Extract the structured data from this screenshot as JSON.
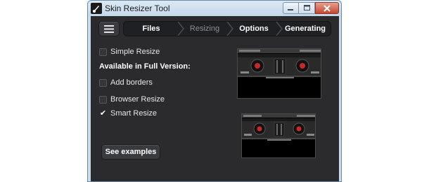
{
  "window": {
    "title": "Skin Resizer Tool",
    "icon": "app-music-note-icon",
    "controls": [
      "minimize-icon",
      "maximize-icon",
      "close-icon"
    ]
  },
  "nav": {
    "menu_icon": "hamburger-menu-icon",
    "steps": [
      {
        "label": "Files",
        "state": "done"
      },
      {
        "label": "Resizing",
        "state": "current"
      },
      {
        "label": "Options",
        "state": "done"
      },
      {
        "label": "Generating",
        "state": "done"
      }
    ]
  },
  "options": {
    "simple_resize": {
      "label": "Simple Resize",
      "checked": false
    },
    "full_version_heading": "Available in Full Version:",
    "add_borders": {
      "label": "Add borders",
      "checked": false
    },
    "browser_resize": {
      "label": "Browser Resize",
      "checked": false
    },
    "smart_resize": {
      "label": "Smart Resize",
      "checked": true
    }
  },
  "buttons": {
    "see_examples": "See examples"
  },
  "previews": {
    "large": "skin-preview-large",
    "small": "skin-preview-small"
  },
  "colors": {
    "background": "#2b2b2e",
    "titlebar": "#c4d8ea",
    "close_button": "#c8452c",
    "preview_accent": "#c8282a"
  }
}
